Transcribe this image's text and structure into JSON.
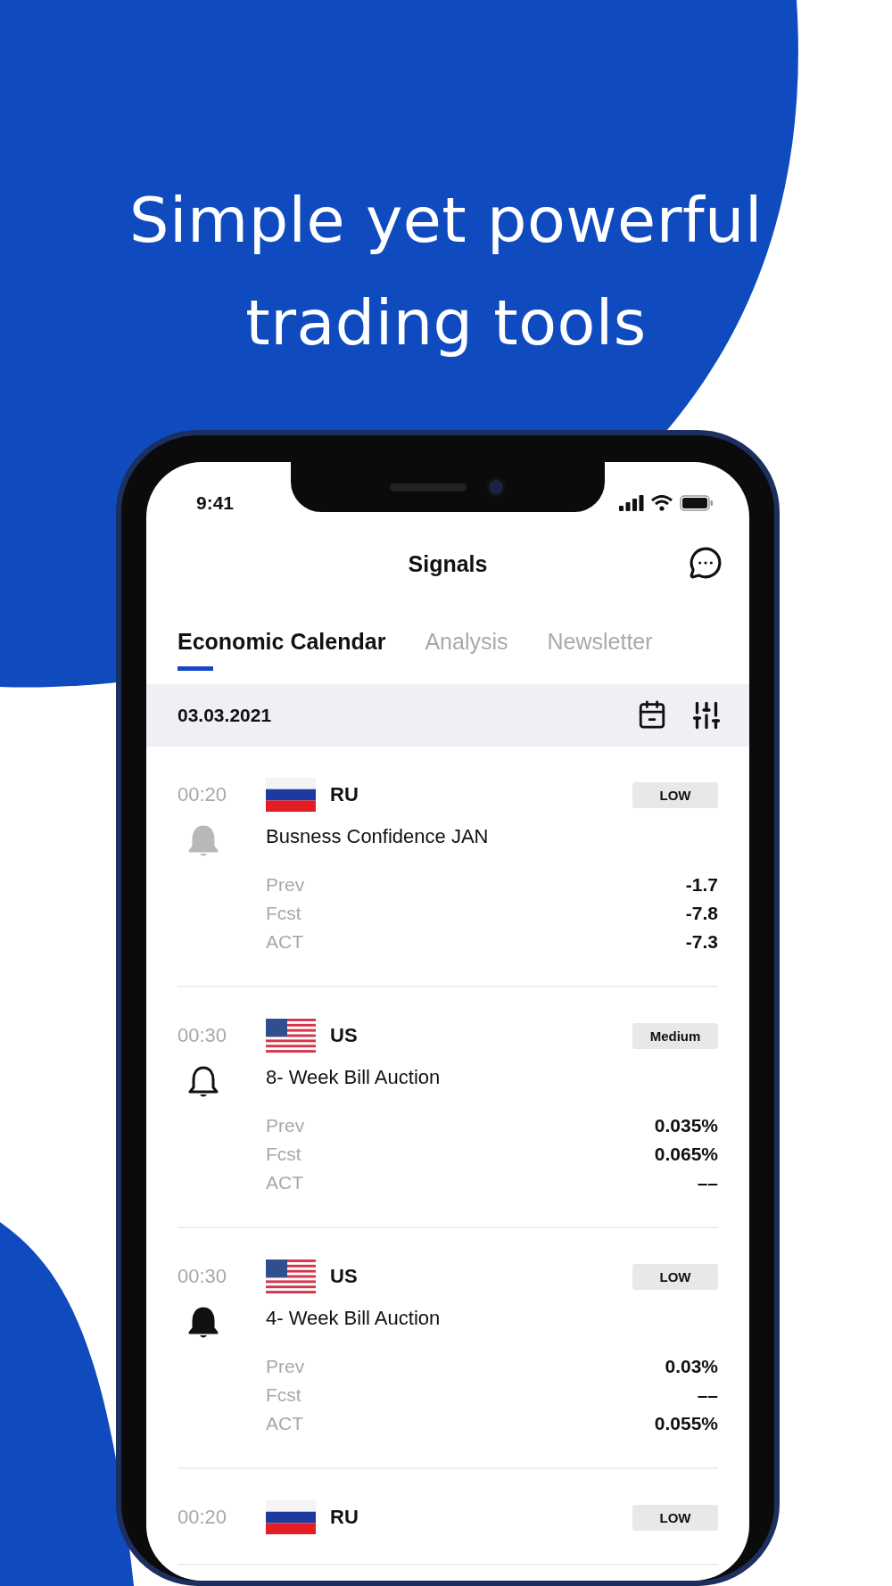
{
  "headline": {
    "lines": [
      "Simple yet powerful",
      "trading tools"
    ]
  },
  "status_bar": {
    "time": "9:41"
  },
  "header": {
    "title": "Signals"
  },
  "tabs": [
    {
      "label": "Economic Calendar",
      "selected": true
    },
    {
      "label": "Analysis",
      "selected": false
    },
    {
      "label": "Newsletter",
      "selected": false
    }
  ],
  "date_bar": {
    "date": "03.03.2021"
  },
  "events": [
    {
      "time": "00:20",
      "flag": {
        "kind": "ru"
      },
      "country": "RU",
      "importance": "LOW",
      "bell": {
        "kind": "expired"
      },
      "title": "Busness Confidence JAN",
      "stats": [
        {
          "label": "Prev",
          "value": "-1.7"
        },
        {
          "label": "Fcst",
          "value": "-7.8"
        },
        {
          "label": "ACT",
          "value": "-7.3"
        }
      ]
    },
    {
      "time": "00:30",
      "flag": {
        "kind": "us"
      },
      "country": "US",
      "importance": "Medium",
      "bell": {
        "kind": "off"
      },
      "title": "8- Week Bill Auction",
      "stats": [
        {
          "label": "Prev",
          "value": "0.035%"
        },
        {
          "label": "Fcst",
          "value": "0.065%"
        },
        {
          "label": "ACT",
          "value": "––"
        }
      ]
    },
    {
      "time": "00:30",
      "flag": {
        "kind": "us"
      },
      "country": "US",
      "importance": "LOW",
      "bell": {
        "kind": "on"
      },
      "title": "4- Week Bill Auction",
      "stats": [
        {
          "label": "Prev",
          "value": "0.03%"
        },
        {
          "label": "Fcst",
          "value": "––"
        },
        {
          "label": "ACT",
          "value": "0.055%"
        }
      ]
    },
    {
      "time": "00:20",
      "flag": {
        "kind": "ru"
      },
      "country": "RU",
      "importance": "LOW"
    }
  ]
}
